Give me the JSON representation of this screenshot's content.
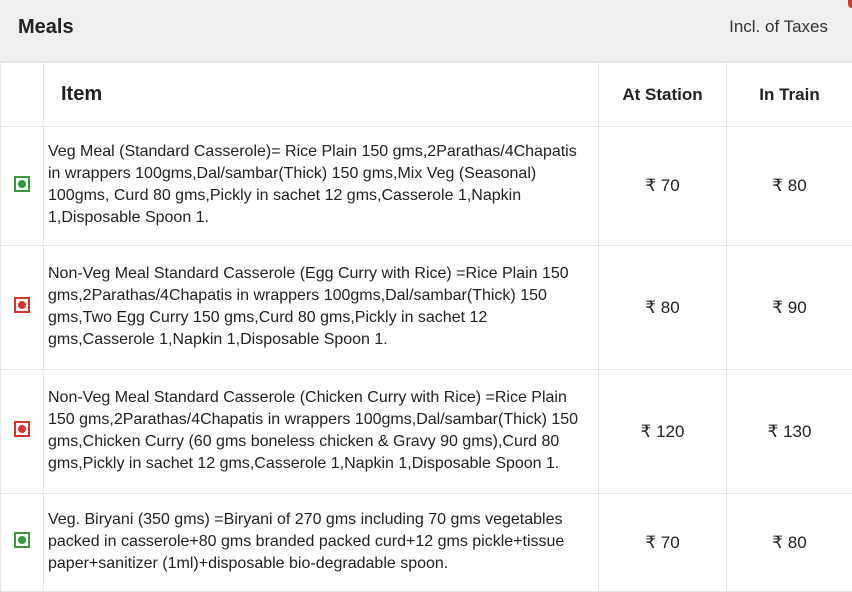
{
  "header": {
    "title": "Meals",
    "tax_note": "Incl. of Taxes"
  },
  "table": {
    "columns": {
      "item": "Item",
      "at_station": "At Station",
      "in_train": "In Train"
    },
    "rows": [
      {
        "type": "veg",
        "description": " Veg Meal (Standard Casserole)= Rice Plain 150 gms,2Parathas/4Chapatis in wrappers 100gms,Dal/sambar(Thick) 150 gms,Mix Veg (Seasonal) 100gms, Curd 80 gms,Pickly in sachet 12 gms,Casserole 1,Napkin 1,Disposable Spoon 1.",
        "at_station": "₹ 70",
        "in_train": "₹ 80"
      },
      {
        "type": "non-veg",
        "description": "Non-Veg Meal Standard Casserole (Egg Curry with Rice) =Rice Plain 150 gms,2Parathas/4Chapatis in wrappers 100gms,Dal/sambar(Thick) 150 gms,Two Egg Curry 150 gms,Curd 80 gms,Pickly in sachet 12 gms,Casserole 1,Napkin 1,Disposable Spoon 1.",
        "at_station": "₹ 80",
        "in_train": "₹ 90"
      },
      {
        "type": "non-veg",
        "description": "Non-Veg Meal Standard Casserole (Chicken Curry with Rice) =Rice Plain 150 gms,2Parathas/4Chapatis in wrappers 100gms,Dal/sambar(Thick) 150 gms,Chicken Curry (60 gms boneless chicken & Gravy 90 gms),Curd 80 gms,Pickly in sachet 12 gms,Casserole 1,Napkin 1,Disposable Spoon 1.",
        "at_station": "₹ 120",
        "in_train": "₹ 130"
      },
      {
        "type": "veg",
        "description": "Veg. Biryani (350 gms) =Biryani of 270 gms including 70 gms vegetables packed in casserole+80 gms branded packed curd+12 gms pickle+tissue paper+sanitizer (1ml)+disposable bio-degradable spoon.",
        "at_station": "₹ 70",
        "in_train": "₹ 80"
      }
    ]
  },
  "colors": {
    "veg": "#2e9c3a",
    "non_veg": "#d9342b",
    "header_bg": "#efefef"
  }
}
